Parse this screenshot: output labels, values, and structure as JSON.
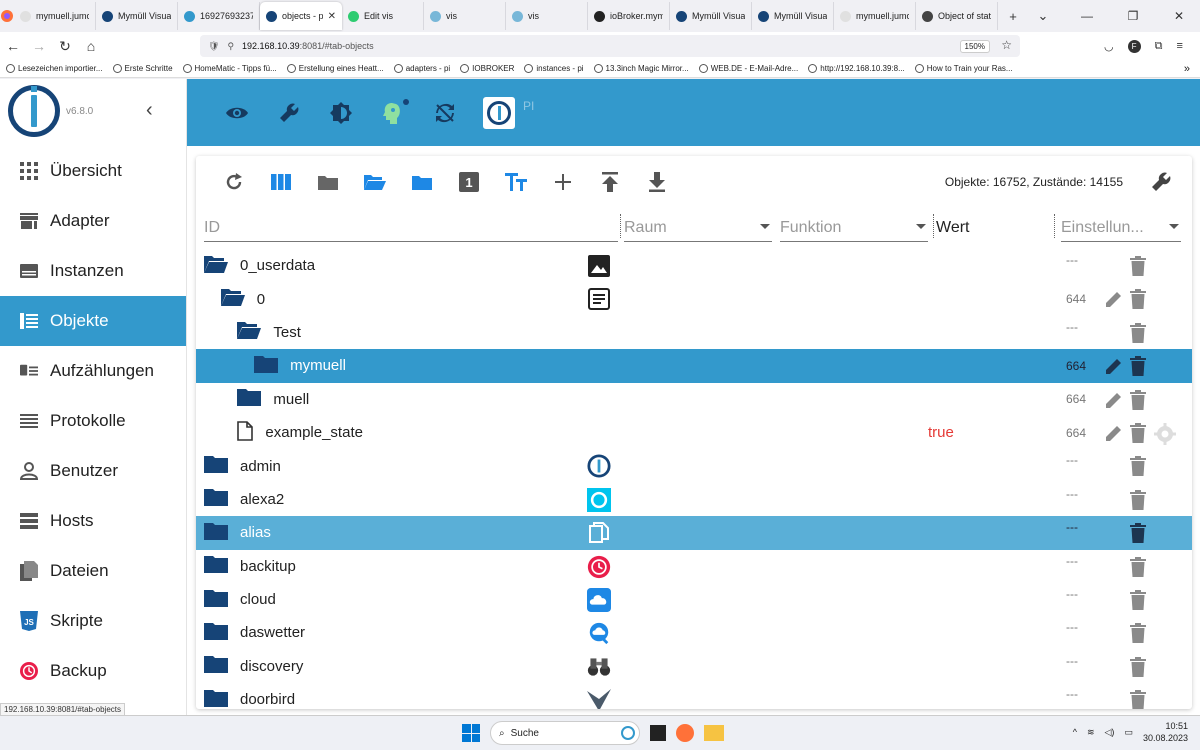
{
  "browser": {
    "tabs": [
      {
        "label": "mymuell.jumomin",
        "color": "#e0e0e0"
      },
      {
        "label": "Mymüll Visual",
        "color": "#164477"
      },
      {
        "label": "16927693237",
        "color": "#3399cc"
      },
      {
        "label": "objects - pi",
        "color": "#164477",
        "active": true
      },
      {
        "label": "Edit vis",
        "color": "#2ecc71"
      },
      {
        "label": "vis",
        "color": "#78b7d8"
      },
      {
        "label": "vis",
        "color": "#78b7d8"
      },
      {
        "label": "ioBroker.mym",
        "color": "#222222"
      },
      {
        "label": "Mymüll Visual",
        "color": "#164477"
      },
      {
        "label": "Mymüll Visual",
        "color": "#164477"
      },
      {
        "label": "mymuell.jumomin",
        "color": "#e0e0e0"
      },
      {
        "label": "Object of stat",
        "color": "#444444"
      }
    ],
    "url_host": "192.168.10.39",
    "url_rest": ":8081/#tab-objects",
    "zoom": "150%",
    "bookmarks": [
      "Lesezeichen importier...",
      "Erste Schritte",
      "HomeMatic - Tipps fü...",
      "Erstellung eines Heatt...",
      "adapters - pi",
      "IOBROKER",
      "instances - pi",
      "13.3inch Magic Mirror...",
      "WEB.DE - E-Mail-Adre...",
      "http://192.168.10.39:8...",
      "How to Train your Ras..."
    ],
    "status_url": "192.168.10.39:8081/#tab-objects"
  },
  "app": {
    "version": "v6.8.0",
    "host": "PI",
    "menu": [
      {
        "label": "Übersicht",
        "icon": "grid-icon"
      },
      {
        "label": "Adapter",
        "icon": "store-icon"
      },
      {
        "label": "Instanzen",
        "icon": "instances-icon"
      },
      {
        "label": "Objekte",
        "icon": "list-icon",
        "active": true
      },
      {
        "label": "Aufzählungen",
        "icon": "enum-icon"
      },
      {
        "label": "Protokolle",
        "icon": "log-icon"
      },
      {
        "label": "Benutzer",
        "icon": "user-icon"
      },
      {
        "label": "Hosts",
        "icon": "hosts-icon"
      },
      {
        "label": "Dateien",
        "icon": "files-icon"
      },
      {
        "label": "Skripte",
        "icon": "js-icon"
      },
      {
        "label": "Backup",
        "icon": "backup-icon"
      }
    ],
    "counts": "Objekte: 16752, Zustände: 14155",
    "columns": {
      "id": "ID",
      "room": "Raum",
      "function": "Funktion",
      "value": "Wert",
      "settings": "Einstellun..."
    },
    "rows": [
      {
        "name": "0_userdata",
        "level": 0,
        "kind": "folder-open",
        "type_icon": "image-icon",
        "acl": "---"
      },
      {
        "name": "0",
        "level": 1,
        "kind": "folder-open",
        "type_icon": "document-icon",
        "acl": "644",
        "edit": true
      },
      {
        "name": "Test",
        "level": 2,
        "kind": "folder-open",
        "acl": "---"
      },
      {
        "name": "mymuell",
        "level": 3,
        "kind": "folder",
        "acl": "664",
        "edit": true,
        "selected": true
      },
      {
        "name": "muell",
        "level": 2,
        "kind": "folder",
        "acl": "664",
        "edit": true
      },
      {
        "name": "example_state",
        "level": 2,
        "kind": "file",
        "value": "true",
        "acl": "664",
        "edit": true,
        "gear": true
      },
      {
        "name": "admin",
        "level": 0,
        "kind": "folder",
        "type_icon": "iobroker-icon",
        "acl": "---"
      },
      {
        "name": "alexa2",
        "level": 0,
        "kind": "folder",
        "type_icon": "alexa-icon",
        "acl": "---"
      },
      {
        "name": "alias",
        "level": 0,
        "kind": "folder",
        "type_icon": "copy-icon",
        "acl": "---",
        "hover": true
      },
      {
        "name": "backitup",
        "level": 0,
        "kind": "folder",
        "type_icon": "backup-icon",
        "acl": "---"
      },
      {
        "name": "cloud",
        "level": 0,
        "kind": "folder",
        "type_icon": "cloud-icon",
        "acl": "---"
      },
      {
        "name": "daswetter",
        "level": 0,
        "kind": "folder",
        "type_icon": "weather-icon",
        "acl": "---"
      },
      {
        "name": "discovery",
        "level": 0,
        "kind": "folder",
        "type_icon": "binoculars-icon",
        "acl": "---"
      },
      {
        "name": "doorbird",
        "level": 0,
        "kind": "folder",
        "type_icon": "doorbird-icon",
        "acl": "---"
      }
    ]
  },
  "taskbar": {
    "search": "Suche",
    "time": "10:51",
    "date": "30.08.2023"
  }
}
